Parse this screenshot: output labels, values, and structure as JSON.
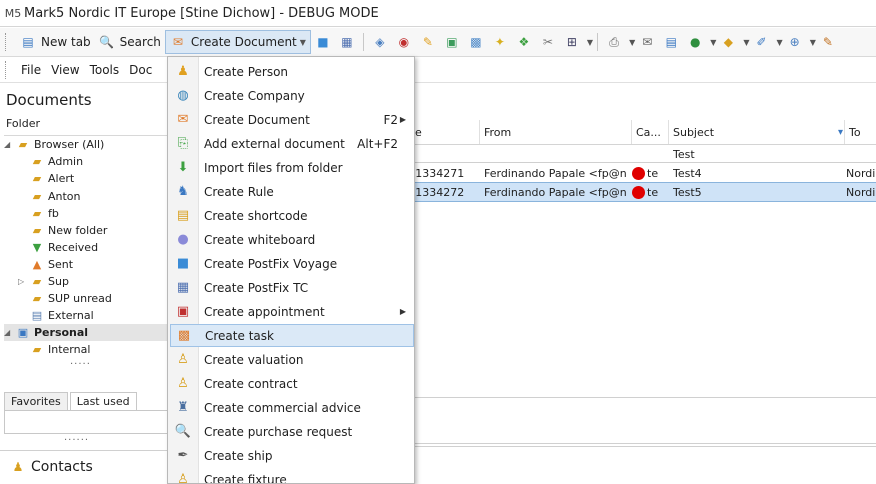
{
  "window": {
    "logo": "M5",
    "title": "Mark5 Nordic IT Europe [Stine Dichow] - DEBUG MODE"
  },
  "toolbar": {
    "new_tab": "New tab",
    "search": "Search",
    "create_document": "Create Document"
  },
  "menubar": {
    "items": [
      "File",
      "View",
      "Tools",
      "Doc"
    ]
  },
  "left": {
    "title": "Documents",
    "folder_header": "Folder",
    "tree": [
      {
        "label": "Browser (All)"
      },
      {
        "label": "Admin"
      },
      {
        "label": "Alert"
      },
      {
        "label": "Anton"
      },
      {
        "label": "fb"
      },
      {
        "label": "New folder"
      },
      {
        "label": "Received"
      },
      {
        "label": "Sent"
      },
      {
        "label": "Sup"
      },
      {
        "label": "SUP unread"
      },
      {
        "label": "External"
      },
      {
        "label": "Personal"
      },
      {
        "label": "Internal"
      }
    ],
    "tabs": [
      "Favorites",
      "Last used"
    ],
    "contacts": "Contacts"
  },
  "grid": {
    "columns": [
      "e",
      "From",
      "Ca...",
      "Subject",
      "To"
    ],
    "filter_row_subject": "Test",
    "rows": [
      {
        "id": ")1334271",
        "from": "Ferdinando Papale <fp@n...",
        "cat": "te",
        "subject": "Test4",
        "to": "Nordic"
      },
      {
        "id": ")1334272",
        "from": "Ferdinando Papale <fp@n...",
        "cat": "te",
        "subject": "Test5",
        "to": "Nordic"
      }
    ]
  },
  "menu": {
    "items": [
      {
        "label": "Create Person",
        "shortcut": ""
      },
      {
        "label": "Create Company",
        "shortcut": ""
      },
      {
        "label": "Create Document",
        "shortcut": "F2"
      },
      {
        "label": "Add external document",
        "shortcut": "Alt+F2"
      },
      {
        "label": "Import files from folder",
        "shortcut": ""
      },
      {
        "label": "Create Rule",
        "shortcut": ""
      },
      {
        "label": "Create shortcode",
        "shortcut": ""
      },
      {
        "label": "Create whiteboard",
        "shortcut": ""
      },
      {
        "label": "Create PostFix Voyage",
        "shortcut": ""
      },
      {
        "label": "Create PostFix TC",
        "shortcut": ""
      },
      {
        "label": "Create appointment",
        "shortcut": ""
      },
      {
        "label": "Create task",
        "shortcut": ""
      },
      {
        "label": "Create valuation",
        "shortcut": ""
      },
      {
        "label": "Create contract",
        "shortcut": ""
      },
      {
        "label": "Create commercial advice",
        "shortcut": ""
      },
      {
        "label": "Create purchase request",
        "shortcut": ""
      },
      {
        "label": "Create ship",
        "shortcut": ""
      },
      {
        "label": "Create fixture",
        "shortcut": ""
      }
    ]
  },
  "colors": {
    "highlight": "#dbe9f7",
    "selected_row": "#cfe3f7",
    "red_flag": "#e00000"
  }
}
